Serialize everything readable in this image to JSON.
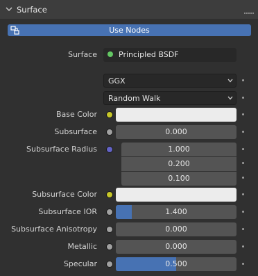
{
  "header": {
    "title": "Surface"
  },
  "use_nodes": {
    "label": "Use Nodes"
  },
  "surface": {
    "label": "Surface",
    "value": "Principled BSDF"
  },
  "distribution": {
    "value": "GGX"
  },
  "subsurface_method": {
    "value": "Random Walk"
  },
  "properties": {
    "base_color": {
      "label": "Base Color",
      "color": "#ececec"
    },
    "subsurface": {
      "label": "Subsurface",
      "value": "0.000"
    },
    "subsurface_radius": {
      "label": "Subsurface Radius",
      "values": [
        "1.000",
        "0.200",
        "0.100"
      ]
    },
    "subsurface_color": {
      "label": "Subsurface Color",
      "color": "#ececec"
    },
    "subsurface_ior": {
      "label": "Subsurface IOR",
      "value": "1.400",
      "fraction": 0.133
    },
    "subsurface_anisotropy": {
      "label": "Subsurface Anisotropy",
      "value": "0.000"
    },
    "metallic": {
      "label": "Metallic",
      "value": "0.000"
    },
    "specular": {
      "label": "Specular",
      "value": "0.500",
      "fraction": 0.5
    }
  },
  "colors": {
    "accent": "#4772b3",
    "socket_color": "#c7c729",
    "socket_float": "#a1a1a1",
    "socket_vector": "#6363c7",
    "socket_shader": "#63c763"
  },
  "icons": {
    "collapse": "chevron-down-icon",
    "node_tree": "node-tree-icon",
    "grip": "drag-grip-icon",
    "dropdown": "dropdown-arrow-icon",
    "decorator": "decorator-dot-icon"
  }
}
